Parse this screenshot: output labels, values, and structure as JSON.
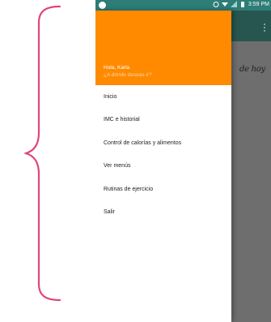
{
  "annotation": {
    "brace_color": "#e0457b"
  },
  "statusbar": {
    "time": "3:59 PM"
  },
  "drawer": {
    "header_color": "#ff8a00",
    "greeting": "Hola, Karla",
    "subtitle": "¿A dónde deseas ir?",
    "items": [
      {
        "label": "Inicio"
      },
      {
        "label": "IMC e historial"
      },
      {
        "label": "Control de calorías y alimentos"
      },
      {
        "label": "Ver menús"
      },
      {
        "label": "Rutinas de ejercicio"
      },
      {
        "label": "Salir"
      }
    ]
  },
  "background_screen": {
    "partial_text": "de hoy"
  }
}
